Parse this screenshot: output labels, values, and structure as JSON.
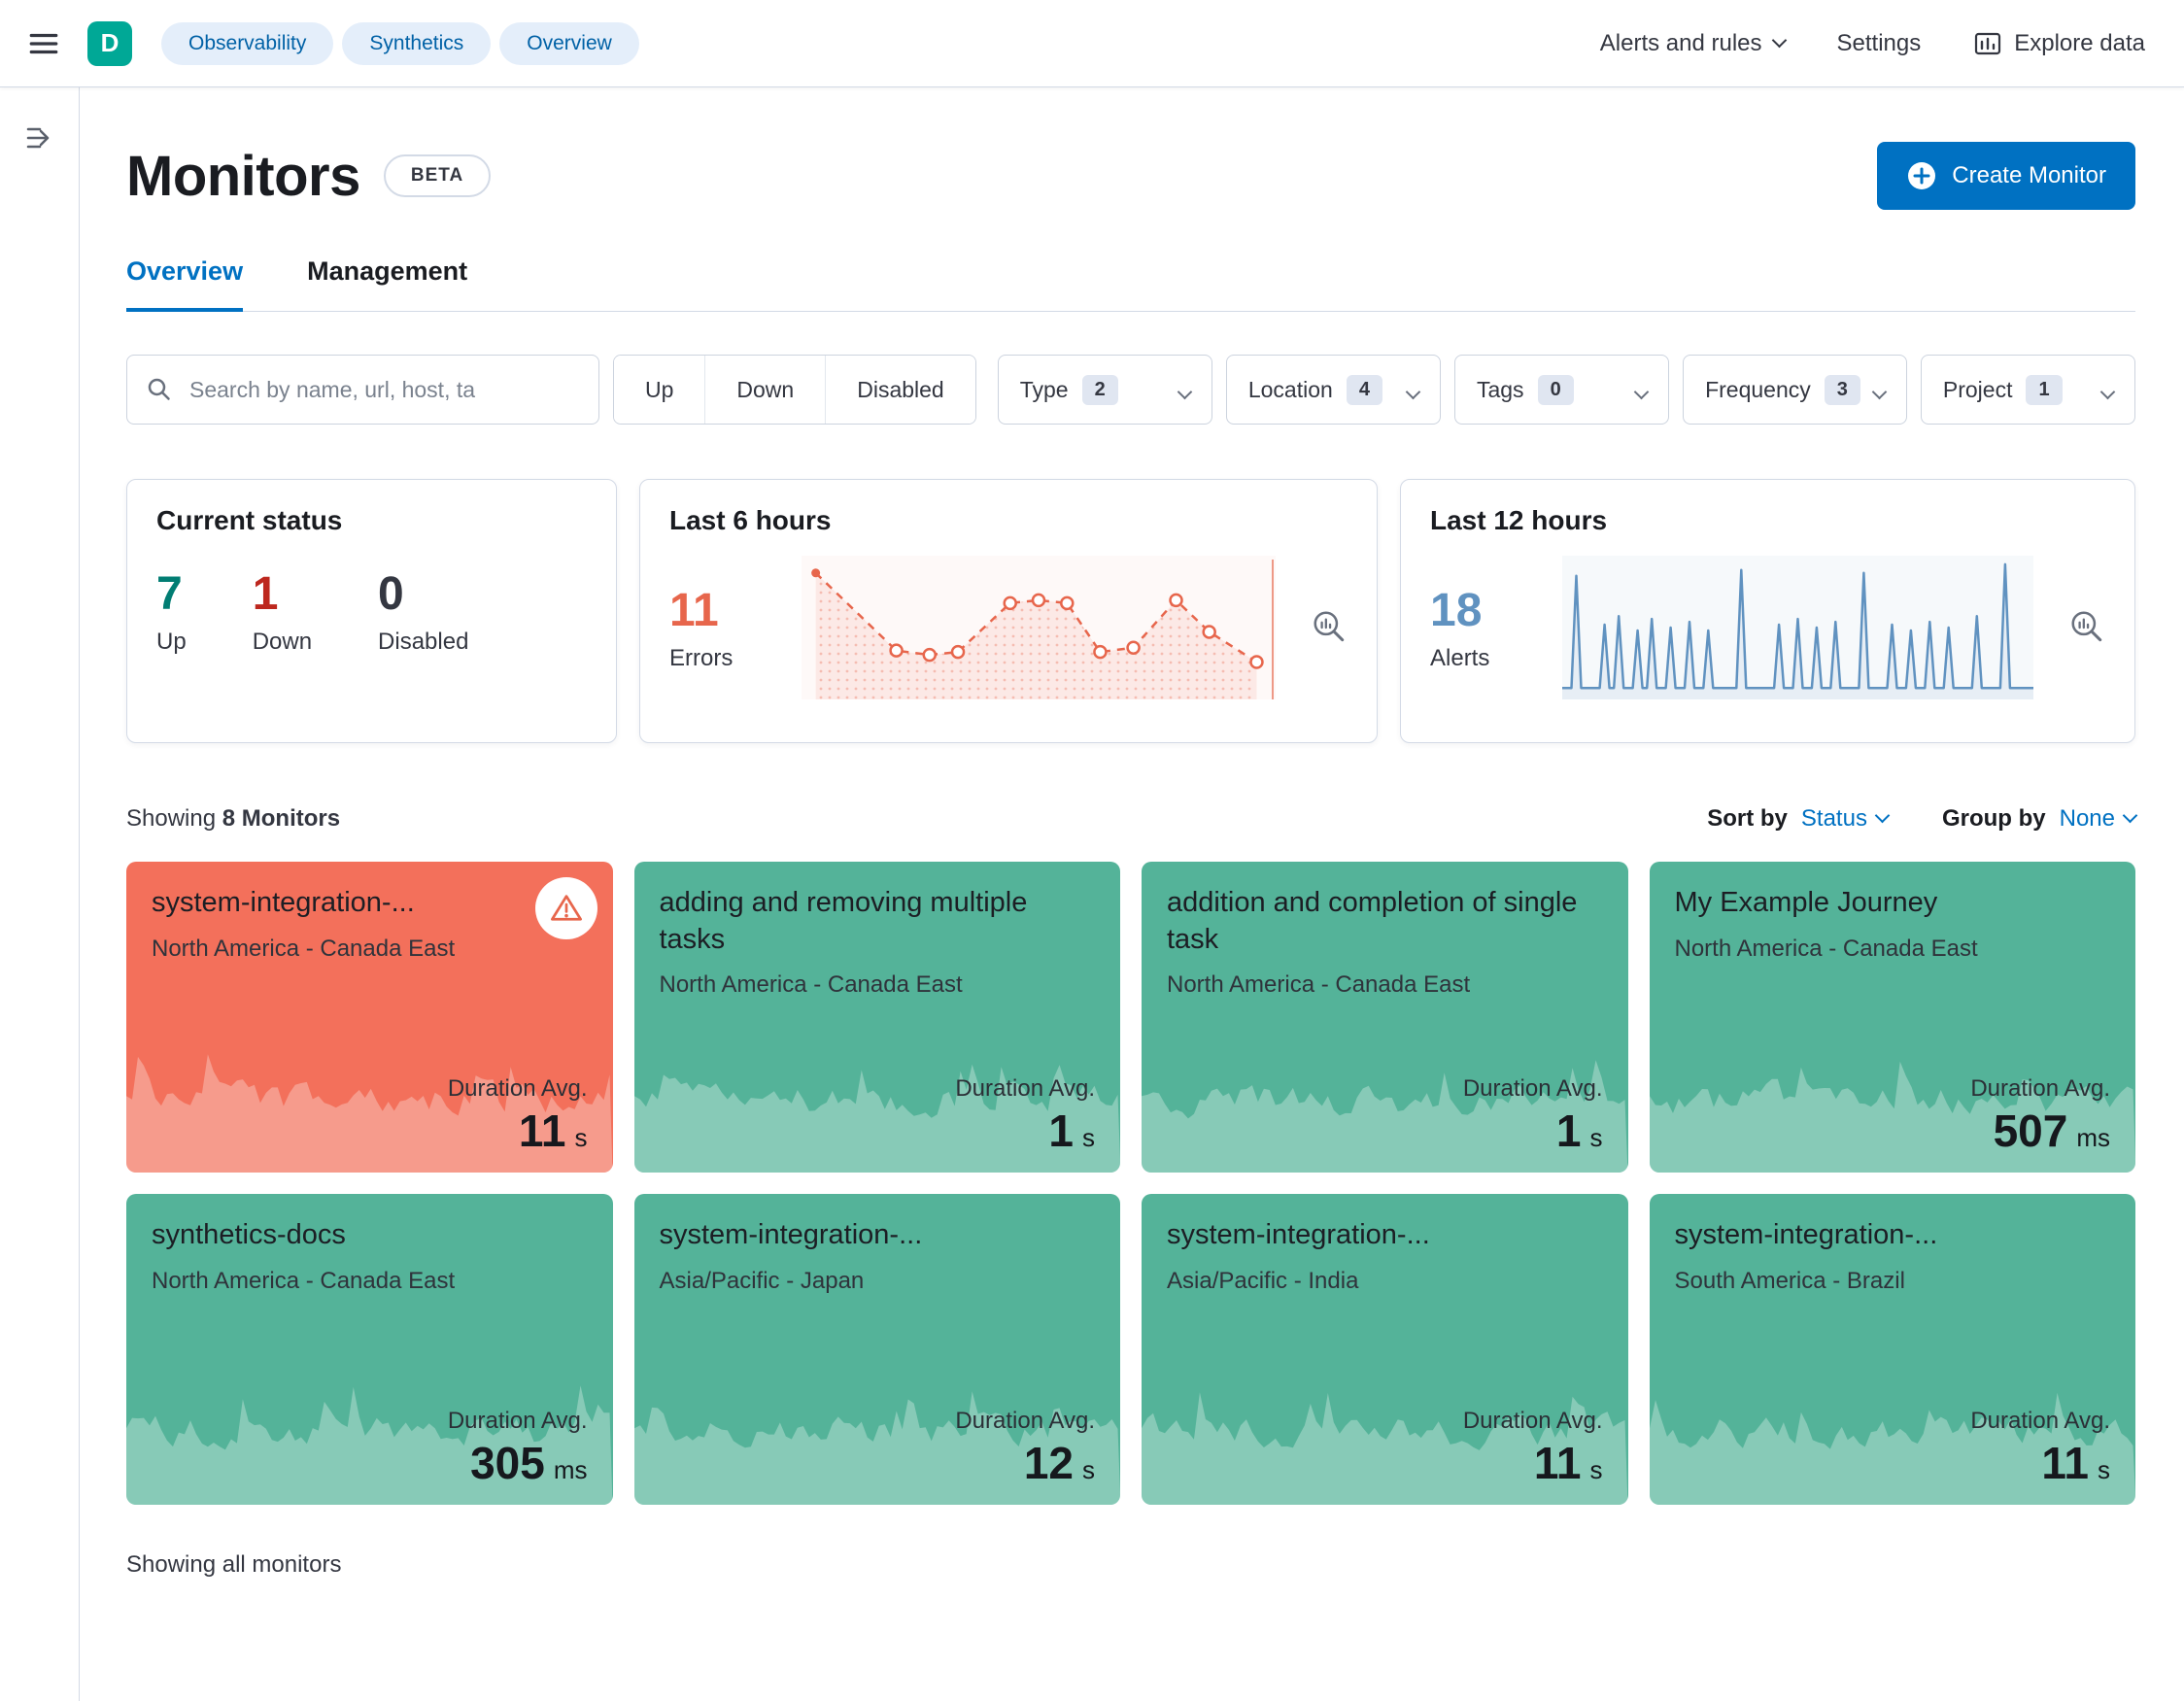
{
  "header": {
    "space_avatar": "D",
    "breadcrumbs": [
      "Observability",
      "Synthetics",
      "Overview"
    ],
    "nav_right": {
      "alerts_menu": "Alerts and rules",
      "settings": "Settings",
      "explore_data": "Explore data"
    }
  },
  "page": {
    "title": "Monitors",
    "beta": "BETA",
    "create_monitor": "Create Monitor",
    "tabs": [
      {
        "label": "Overview",
        "active": true
      },
      {
        "label": "Management",
        "active": false
      }
    ]
  },
  "filters": {
    "search_placeholder": "Search by name, url, host, ta",
    "status_buttons": [
      "Up",
      "Down",
      "Disabled"
    ],
    "dropdowns": [
      {
        "label": "Type",
        "count": "2"
      },
      {
        "label": "Location",
        "count": "4"
      },
      {
        "label": "Tags",
        "count": "0"
      },
      {
        "label": "Frequency",
        "count": "3"
      },
      {
        "label": "Project",
        "count": "1"
      }
    ]
  },
  "stats": {
    "current_status": {
      "title": "Current status",
      "items": [
        {
          "value": "7",
          "label": "Up",
          "color": "#017d73"
        },
        {
          "value": "1",
          "label": "Down",
          "color": "#bd271e"
        },
        {
          "value": "0",
          "label": "Disabled",
          "color": "#343741"
        }
      ]
    },
    "last6": {
      "title": "Last 6 hours",
      "value": "11",
      "label": "Errors",
      "color": "#e7664c"
    },
    "last12": {
      "title": "Last 12 hours",
      "value": "18",
      "label": "Alerts",
      "color": "#6092c0"
    }
  },
  "chart_data": [
    {
      "name": "errors-sparkline",
      "type": "line",
      "title": "Last 6 hours",
      "metric": "Errors",
      "total": 11,
      "style": {
        "stroke": "#e7664c",
        "dashed": true,
        "markers": true,
        "fill": "rgba(231,102,76,0.10)"
      },
      "points": [
        [
          3,
          12
        ],
        [
          20,
          66
        ],
        [
          27,
          69
        ],
        [
          33,
          67
        ],
        [
          44,
          33
        ],
        [
          50,
          31
        ],
        [
          56,
          33
        ],
        [
          63,
          67
        ],
        [
          70,
          64
        ],
        [
          79,
          31
        ],
        [
          86,
          53
        ],
        [
          96,
          74
        ]
      ]
    },
    {
      "name": "alerts-sparkline",
      "type": "line",
      "title": "Last 12 hours",
      "metric": "Alerts",
      "total": 18,
      "style": {
        "stroke": "#6092c0",
        "dashed": false,
        "markers": false,
        "fill": "rgba(96,146,192,0.10)"
      },
      "baseline": 92,
      "spikes": [
        [
          3,
          14
        ],
        [
          9,
          48
        ],
        [
          12,
          42
        ],
        [
          16,
          52
        ],
        [
          19,
          44
        ],
        [
          23,
          50
        ],
        [
          27,
          46
        ],
        [
          31,
          52
        ],
        [
          38,
          10
        ],
        [
          46,
          48
        ],
        [
          50,
          44
        ],
        [
          54,
          50
        ],
        [
          58,
          46
        ],
        [
          64,
          12
        ],
        [
          70,
          48
        ],
        [
          74,
          52
        ],
        [
          78,
          46
        ],
        [
          82,
          50
        ],
        [
          88,
          42
        ],
        [
          94,
          6
        ]
      ]
    }
  ],
  "monitor_list": {
    "showing_prefix": "Showing",
    "showing_count": "8 Monitors",
    "sort_by_label": "Sort by",
    "sort_by_value": "Status",
    "group_by_label": "Group by",
    "group_by_value": "None",
    "duration_label": "Duration Avg.",
    "footer": "Showing all monitors"
  },
  "monitors": [
    {
      "name": "system-integration-...",
      "location": "North America - Canada East",
      "duration": "11",
      "unit": "s",
      "status": "down"
    },
    {
      "name": "adding and removing multiple tasks",
      "location": "North America - Canada East",
      "duration": "1",
      "unit": "s",
      "status": "up"
    },
    {
      "name": "addition and completion of single task",
      "location": "North America - Canada East",
      "duration": "1",
      "unit": "s",
      "status": "up"
    },
    {
      "name": "My Example Journey",
      "location": "North America - Canada East",
      "duration": "507",
      "unit": "ms",
      "status": "up"
    },
    {
      "name": "synthetics-docs",
      "location": "North America - Canada East",
      "duration": "305",
      "unit": "ms",
      "status": "up"
    },
    {
      "name": "system-integration-...",
      "location": "Asia/Pacific - Japan",
      "duration": "12",
      "unit": "s",
      "status": "up"
    },
    {
      "name": "system-integration-...",
      "location": "Asia/Pacific - India",
      "duration": "11",
      "unit": "s",
      "status": "up"
    },
    {
      "name": "system-integration-...",
      "location": "South America - Brazil",
      "duration": "11",
      "unit": "s",
      "status": "up"
    }
  ],
  "colors": {
    "primary": "#0071c2",
    "up_card": "#54b399",
    "down_card": "#f3705b",
    "error": "#e7664c",
    "alert_blue": "#6092c0",
    "success_text": "#017d73",
    "danger_text": "#bd271e",
    "breadcrumb_bg": "#e4eefa",
    "breadcrumb_text": "#0061a6",
    "avatar_bg": "#00a896",
    "card_border": "#d3dae6"
  },
  "icons": {
    "hamburger": "menu",
    "expand_nav": "arrow-right-with-lines",
    "search": "magnifier",
    "create": "plus-in-circle",
    "explore": "bar-chart-board",
    "inspect": "magnifier-with-bars",
    "alert": "warning-triangle",
    "chevron": "chevron-down"
  }
}
